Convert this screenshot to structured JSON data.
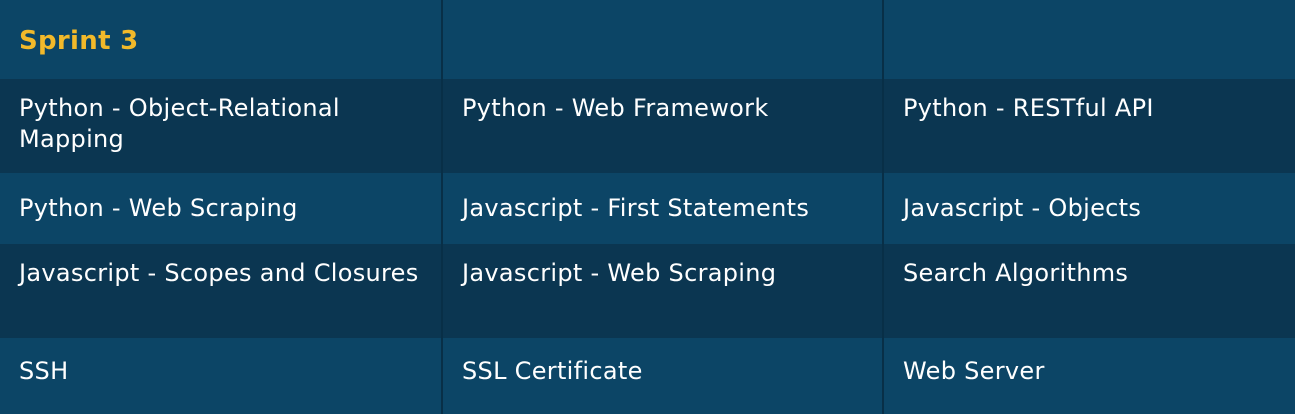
{
  "sprint": {
    "title": "Sprint 3",
    "accent_color": "#f2b92a"
  },
  "rows": [
    [
      "Python - Object-Relational Mapping",
      "Python - Web Framework",
      "Python - RESTful API"
    ],
    [
      "Python - Web Scraping",
      "Javascript - First Statements",
      "Javascript - Objects"
    ],
    [
      "Javascript - Scopes and Closures",
      "Javascript - Web Scraping",
      "Search Algorithms"
    ],
    [
      "SSH",
      "SSL Certificate",
      "Web Server"
    ]
  ]
}
